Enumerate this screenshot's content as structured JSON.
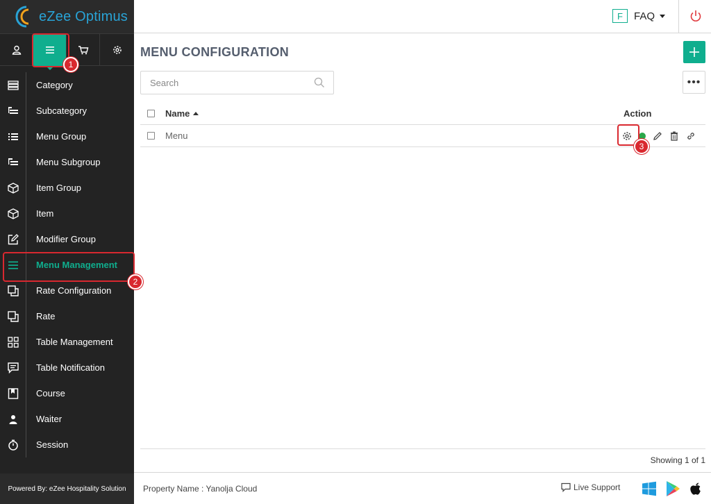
{
  "app": {
    "logo_text": "eZee Optimus"
  },
  "sidebar": {
    "top_tabs": [
      {
        "name": "user-icon"
      },
      {
        "name": "menu-icon",
        "active": true
      },
      {
        "name": "cart-icon"
      },
      {
        "name": "gear-icon"
      }
    ],
    "items": [
      {
        "label": "Category",
        "icon": "category-icon"
      },
      {
        "label": "Subcategory",
        "icon": "subcategory-icon"
      },
      {
        "label": "Menu Group",
        "icon": "list-icon"
      },
      {
        "label": "Menu Subgroup",
        "icon": "subgroup-icon"
      },
      {
        "label": "Item Group",
        "icon": "box-icon"
      },
      {
        "label": "Item",
        "icon": "box-icon"
      },
      {
        "label": "Modifier Group",
        "icon": "edit-icon"
      },
      {
        "label": "Menu Management",
        "icon": "hamburger-icon",
        "active": true
      },
      {
        "label": "Rate Configuration",
        "icon": "copy-icon"
      },
      {
        "label": "Rate",
        "icon": "copy-icon"
      },
      {
        "label": "Table Management",
        "icon": "grid-icon"
      },
      {
        "label": "Table Notification",
        "icon": "message-icon"
      },
      {
        "label": "Course",
        "icon": "bookmark-icon"
      },
      {
        "label": "Waiter",
        "icon": "person-icon"
      },
      {
        "label": "Session",
        "icon": "timer-icon"
      }
    ],
    "footer": "Powered By: eZee Hospitality Solution"
  },
  "header": {
    "faq_letter": "F",
    "faq_label": "FAQ"
  },
  "main": {
    "title": "MENU CONFIGURATION",
    "search_placeholder": "Search",
    "more_label": "•••",
    "columns": {
      "name": "Name",
      "action": "Action"
    },
    "rows": [
      {
        "name": "Menu",
        "status_color": "#2aa74a"
      }
    ],
    "showing": "Showing 1 of 1"
  },
  "footer": {
    "property": "Property Name : Yanolja Cloud",
    "live_support": "Live Support"
  },
  "callouts": [
    "1",
    "2",
    "3"
  ],
  "colors": {
    "accent": "#0fae8e",
    "callout": "#d9282f",
    "logo": "#29a3d6",
    "power": "#e0393e"
  }
}
